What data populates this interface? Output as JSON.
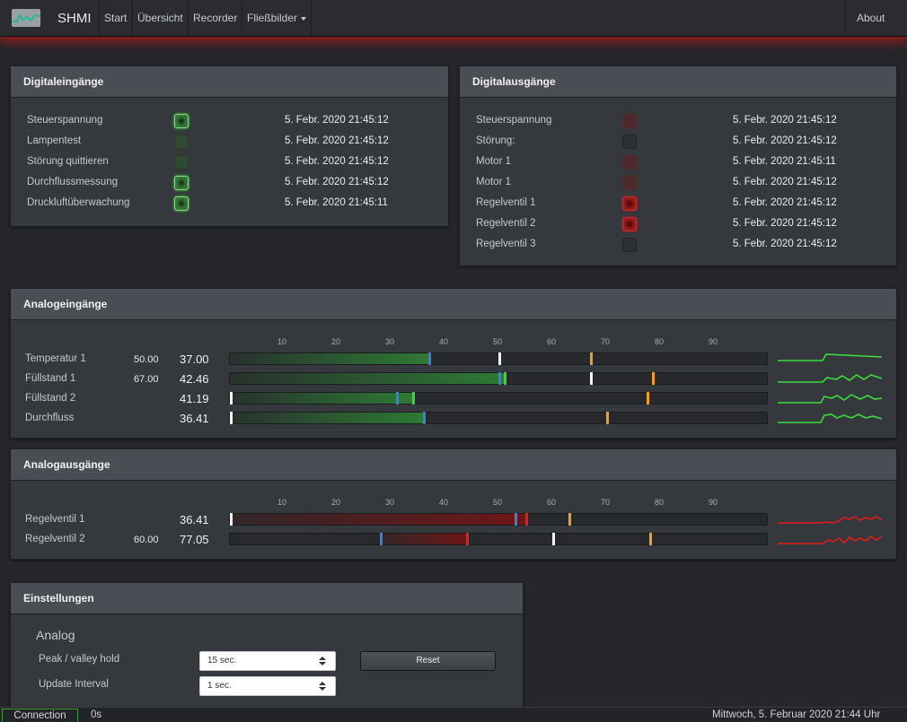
{
  "app": {
    "brand": "SHMI"
  },
  "nav": {
    "start": "Start",
    "overview": "Übersicht",
    "recorder": "Recorder",
    "flow": "Fließbilder",
    "about": "About"
  },
  "digital_inputs": {
    "title": "Digitaleingänge",
    "rows": [
      {
        "label": "Steuerspannung",
        "state": "on",
        "time": "5. Febr. 2020 21:45:12"
      },
      {
        "label": "Lampentest",
        "state": "off",
        "time": "5. Febr. 2020 21:45:12"
      },
      {
        "label": "Störung quittieren",
        "state": "off",
        "time": "5. Febr. 2020 21:45:12"
      },
      {
        "label": "Durchflussmessung",
        "state": "on",
        "time": "5. Febr. 2020 21:45:12"
      },
      {
        "label": "Druckluftüberwachung",
        "state": "on",
        "time": "5. Febr. 2020 21:45:11"
      }
    ]
  },
  "digital_outputs": {
    "title": "Digitalausgänge",
    "rows": [
      {
        "label": "Steuerspannung",
        "state": "dim",
        "time": "5. Febr. 2020 21:45:12"
      },
      {
        "label": "Störung:",
        "state": "off",
        "time": "5. Febr. 2020 21:45:12"
      },
      {
        "label": "Motor 1",
        "state": "dim",
        "time": "5. Febr. 2020 21:45:11"
      },
      {
        "label": "Motor 1",
        "state": "dim",
        "time": "5. Febr. 2020 21:45:12"
      },
      {
        "label": "Regelventil 1",
        "state": "on",
        "time": "5. Febr. 2020 21:45:12"
      },
      {
        "label": "Regelventil 2",
        "state": "on",
        "time": "5. Febr. 2020 21:45:12"
      },
      {
        "label": "Regelventil 3",
        "state": "off",
        "time": "5. Febr. 2020 21:45:12"
      }
    ]
  },
  "scale_ticks": [
    "10",
    "20",
    "30",
    "40",
    "50",
    "60",
    "70",
    "80",
    "90"
  ],
  "analog_inputs": {
    "title": "Analogeingänge",
    "rows": [
      {
        "label": "Temperatur 1",
        "hold": "50.00",
        "value": "37.00",
        "value_num": 37.0,
        "blue": 37.0,
        "white": 50.0,
        "orange": 67.0,
        "green_mark": null,
        "min_mark": null
      },
      {
        "label": "Füllstand 1",
        "hold": "67.00",
        "value": "42.46",
        "value_num": 51.0,
        "blue": 50.0,
        "white": 67.0,
        "orange": 78.5,
        "green_mark": 51.0,
        "min_mark": null
      },
      {
        "label": "Füllstand 2",
        "hold": "",
        "value": "41.19",
        "value_num": 34.0,
        "blue": 31.0,
        "white": null,
        "orange": 77.5,
        "green_mark": 34.0,
        "min_mark": 0.3
      },
      {
        "label": "Durchfluss",
        "hold": "",
        "value": "36.41",
        "value_num": 36.0,
        "blue": 36.0,
        "white": null,
        "orange": 70.0,
        "green_mark": null,
        "min_mark": 0.3
      }
    ]
  },
  "analog_outputs": {
    "title": "Analogausgänge",
    "rows": [
      {
        "label": "Regelventil 1",
        "hold": "",
        "value": "36.41",
        "value_num": 55.0,
        "blue": 53.0,
        "white": null,
        "orange": 63.0,
        "red_mark": 55.0,
        "min_mark": 0.3,
        "fill_from": 0
      },
      {
        "label": "Regelventil 2",
        "hold": "60.00",
        "value": "77.05",
        "value_num": 44.0,
        "blue": 28.0,
        "white": 60.0,
        "orange": 78.0,
        "red_mark": 44.0,
        "min_mark": null,
        "fill_from": 28.0
      }
    ]
  },
  "settings": {
    "title": "Einstellungen",
    "sub": "Analog",
    "peak_label": "Peak / valley hold",
    "peak_value": "15 sec.",
    "update_label": "Update Interval",
    "update_value": "1 sec.",
    "reset_label": "Reset"
  },
  "status": {
    "connection": "Connection",
    "latency": "0s",
    "datetime": "Mittwoch, 5. Februar 2020 21:44 Uhr"
  },
  "colors": {
    "accent_red": "#c81414",
    "led_green": "#4bd34b",
    "led_red": "#d22a2a",
    "blue_marker": "#3a7ce8",
    "orange_marker": "#f0a020"
  }
}
